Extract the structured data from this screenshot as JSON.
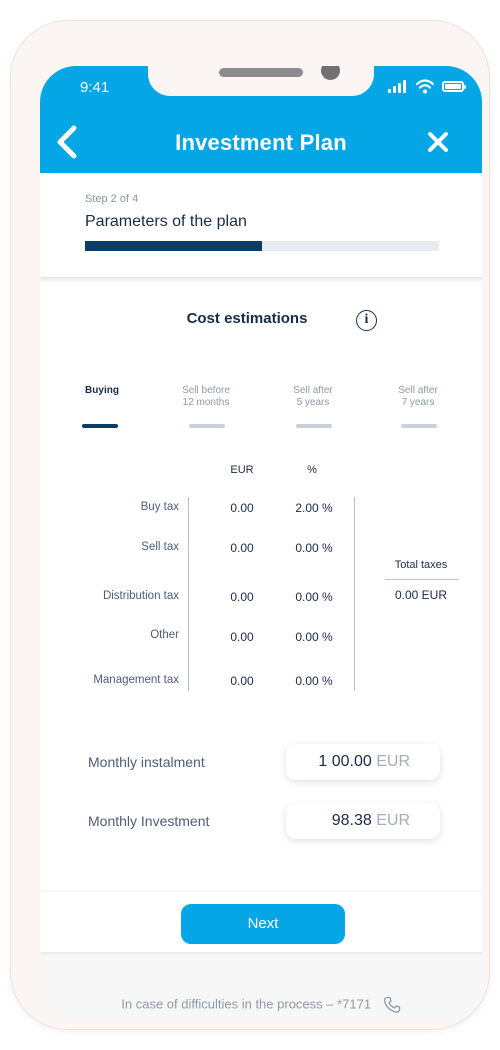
{
  "status_bar": {
    "time": "9:41"
  },
  "header": {
    "title": "Investment Plan"
  },
  "step": {
    "label": "Step 2 of 4",
    "title": "Parameters of the plan",
    "progress": 0.5
  },
  "costs": {
    "title": "Cost estimations",
    "tabs": [
      {
        "label": "Buying",
        "active": true
      },
      {
        "label": "Sell before\n12 months",
        "active": false
      },
      {
        "label": "Sell after\n5 years",
        "active": false
      },
      {
        "label": "Sell after\n7 years",
        "active": false
      }
    ],
    "columns": {
      "eur": "EUR",
      "pct": "%"
    },
    "rows": [
      {
        "label": "Buy tax",
        "eur": "0.00",
        "pct": "2.00 %"
      },
      {
        "label": "Sell tax",
        "eur": "0.00",
        "pct": "0.00 %"
      },
      {
        "label": "Distribution tax",
        "eur": "0.00",
        "pct": "0.00 %"
      },
      {
        "label": "Other",
        "eur": "0.00",
        "pct": "0.00 %"
      },
      {
        "label": "Management tax",
        "eur": "0.00",
        "pct": "0.00 %"
      }
    ],
    "total": {
      "label": "Total taxes",
      "value": "0.00 EUR"
    }
  },
  "fields": {
    "instalment": {
      "label": "Monthly instalment",
      "value": "1 00.00",
      "unit": "EUR"
    },
    "investment": {
      "label": "Monthly Investment",
      "value": "98.38",
      "unit": "EUR"
    }
  },
  "actions": {
    "next": "Next"
  },
  "help": {
    "text": "In case of difficulties in the process –  *7171"
  },
  "colors": {
    "primary": "#04a6e6",
    "dark": "#0b3d66",
    "text": "#1a2b48"
  }
}
